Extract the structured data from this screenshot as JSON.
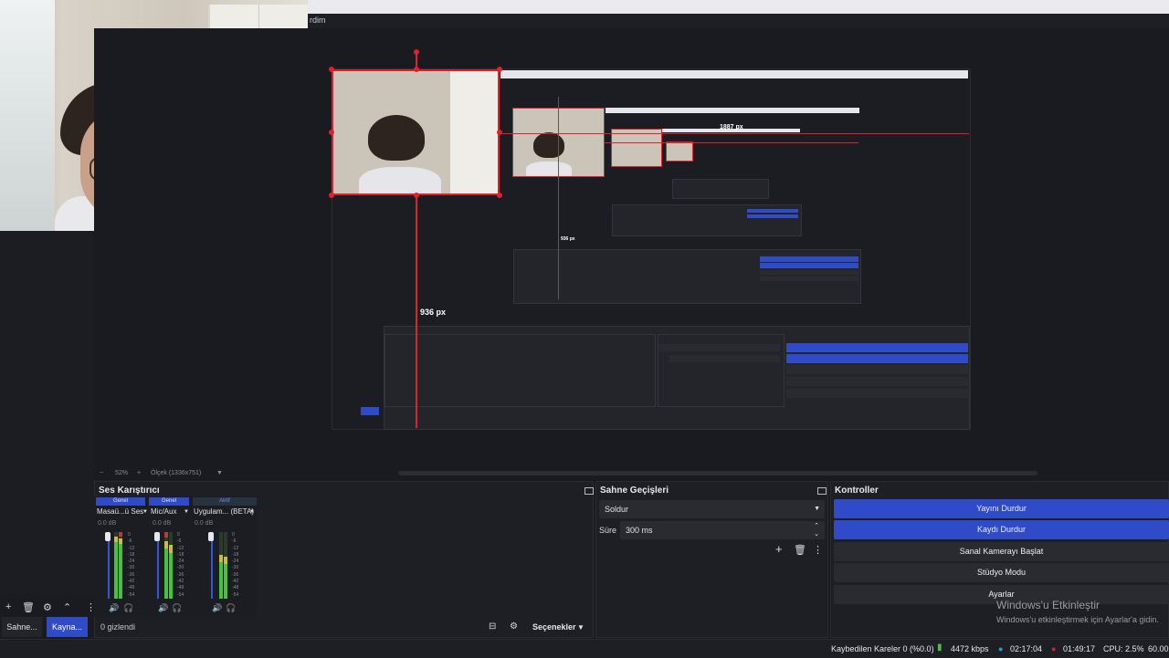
{
  "menubar": {
    "text": "rdim"
  },
  "preview": {
    "label_large": "936 px",
    "label_top": "1887 px",
    "label_small": "936 px",
    "zoom": "52%",
    "scale_text": "Ölçek (1336x751)"
  },
  "mixer": {
    "title": "Ses Karıştırıcı",
    "channels": [
      {
        "tag": "Genel",
        "name": "Masaü...ü Ses",
        "db": "0.0 dB"
      },
      {
        "tag": "Genel",
        "name": "Mic/Aux",
        "db": "0.0 dB"
      },
      {
        "tag": "Aktif",
        "name": "Uygulam... (BETA)",
        "db": "0.0 dB"
      }
    ],
    "scale": [
      "0",
      "-6",
      "-12",
      "-18",
      "-24",
      "-30",
      "-36",
      "-42",
      "-48",
      "-54",
      "-60"
    ]
  },
  "scenes_tab": "Sahne...",
  "sources_tab": "Kayna...",
  "hidden_count": "0 gizlendi",
  "options_label": "Seçenekler",
  "transitions": {
    "title": "Sahne Geçişleri",
    "transition": "Soldur",
    "duration_label": "Süre",
    "duration_value": "300 ms"
  },
  "controls": {
    "title": "Kontroller",
    "buttons": [
      "Yayını Durdur",
      "Kaydı Durdur",
      "Sanal Kamerayı Başlat",
      "Stüdyo Modu",
      "Ayarlar"
    ]
  },
  "watermark": {
    "line1": "Windows'u Etkinleştir",
    "line2": "Windows'u etkinleştirmek için Ayarlar'a gidin."
  },
  "status": {
    "dropped": "Kaybedilen Kareler 0 (%0.0)",
    "bitrate": "4472 kbps",
    "live_time": "02:17:04",
    "rec_time": "01:49:17",
    "cpu": "CPU: 2.5%",
    "fps": "60.00"
  },
  "colors": {
    "accent": "#2f4bc7",
    "selection": "#e0202c",
    "live": "#2e9bd6",
    "rec": "#d2232a"
  }
}
